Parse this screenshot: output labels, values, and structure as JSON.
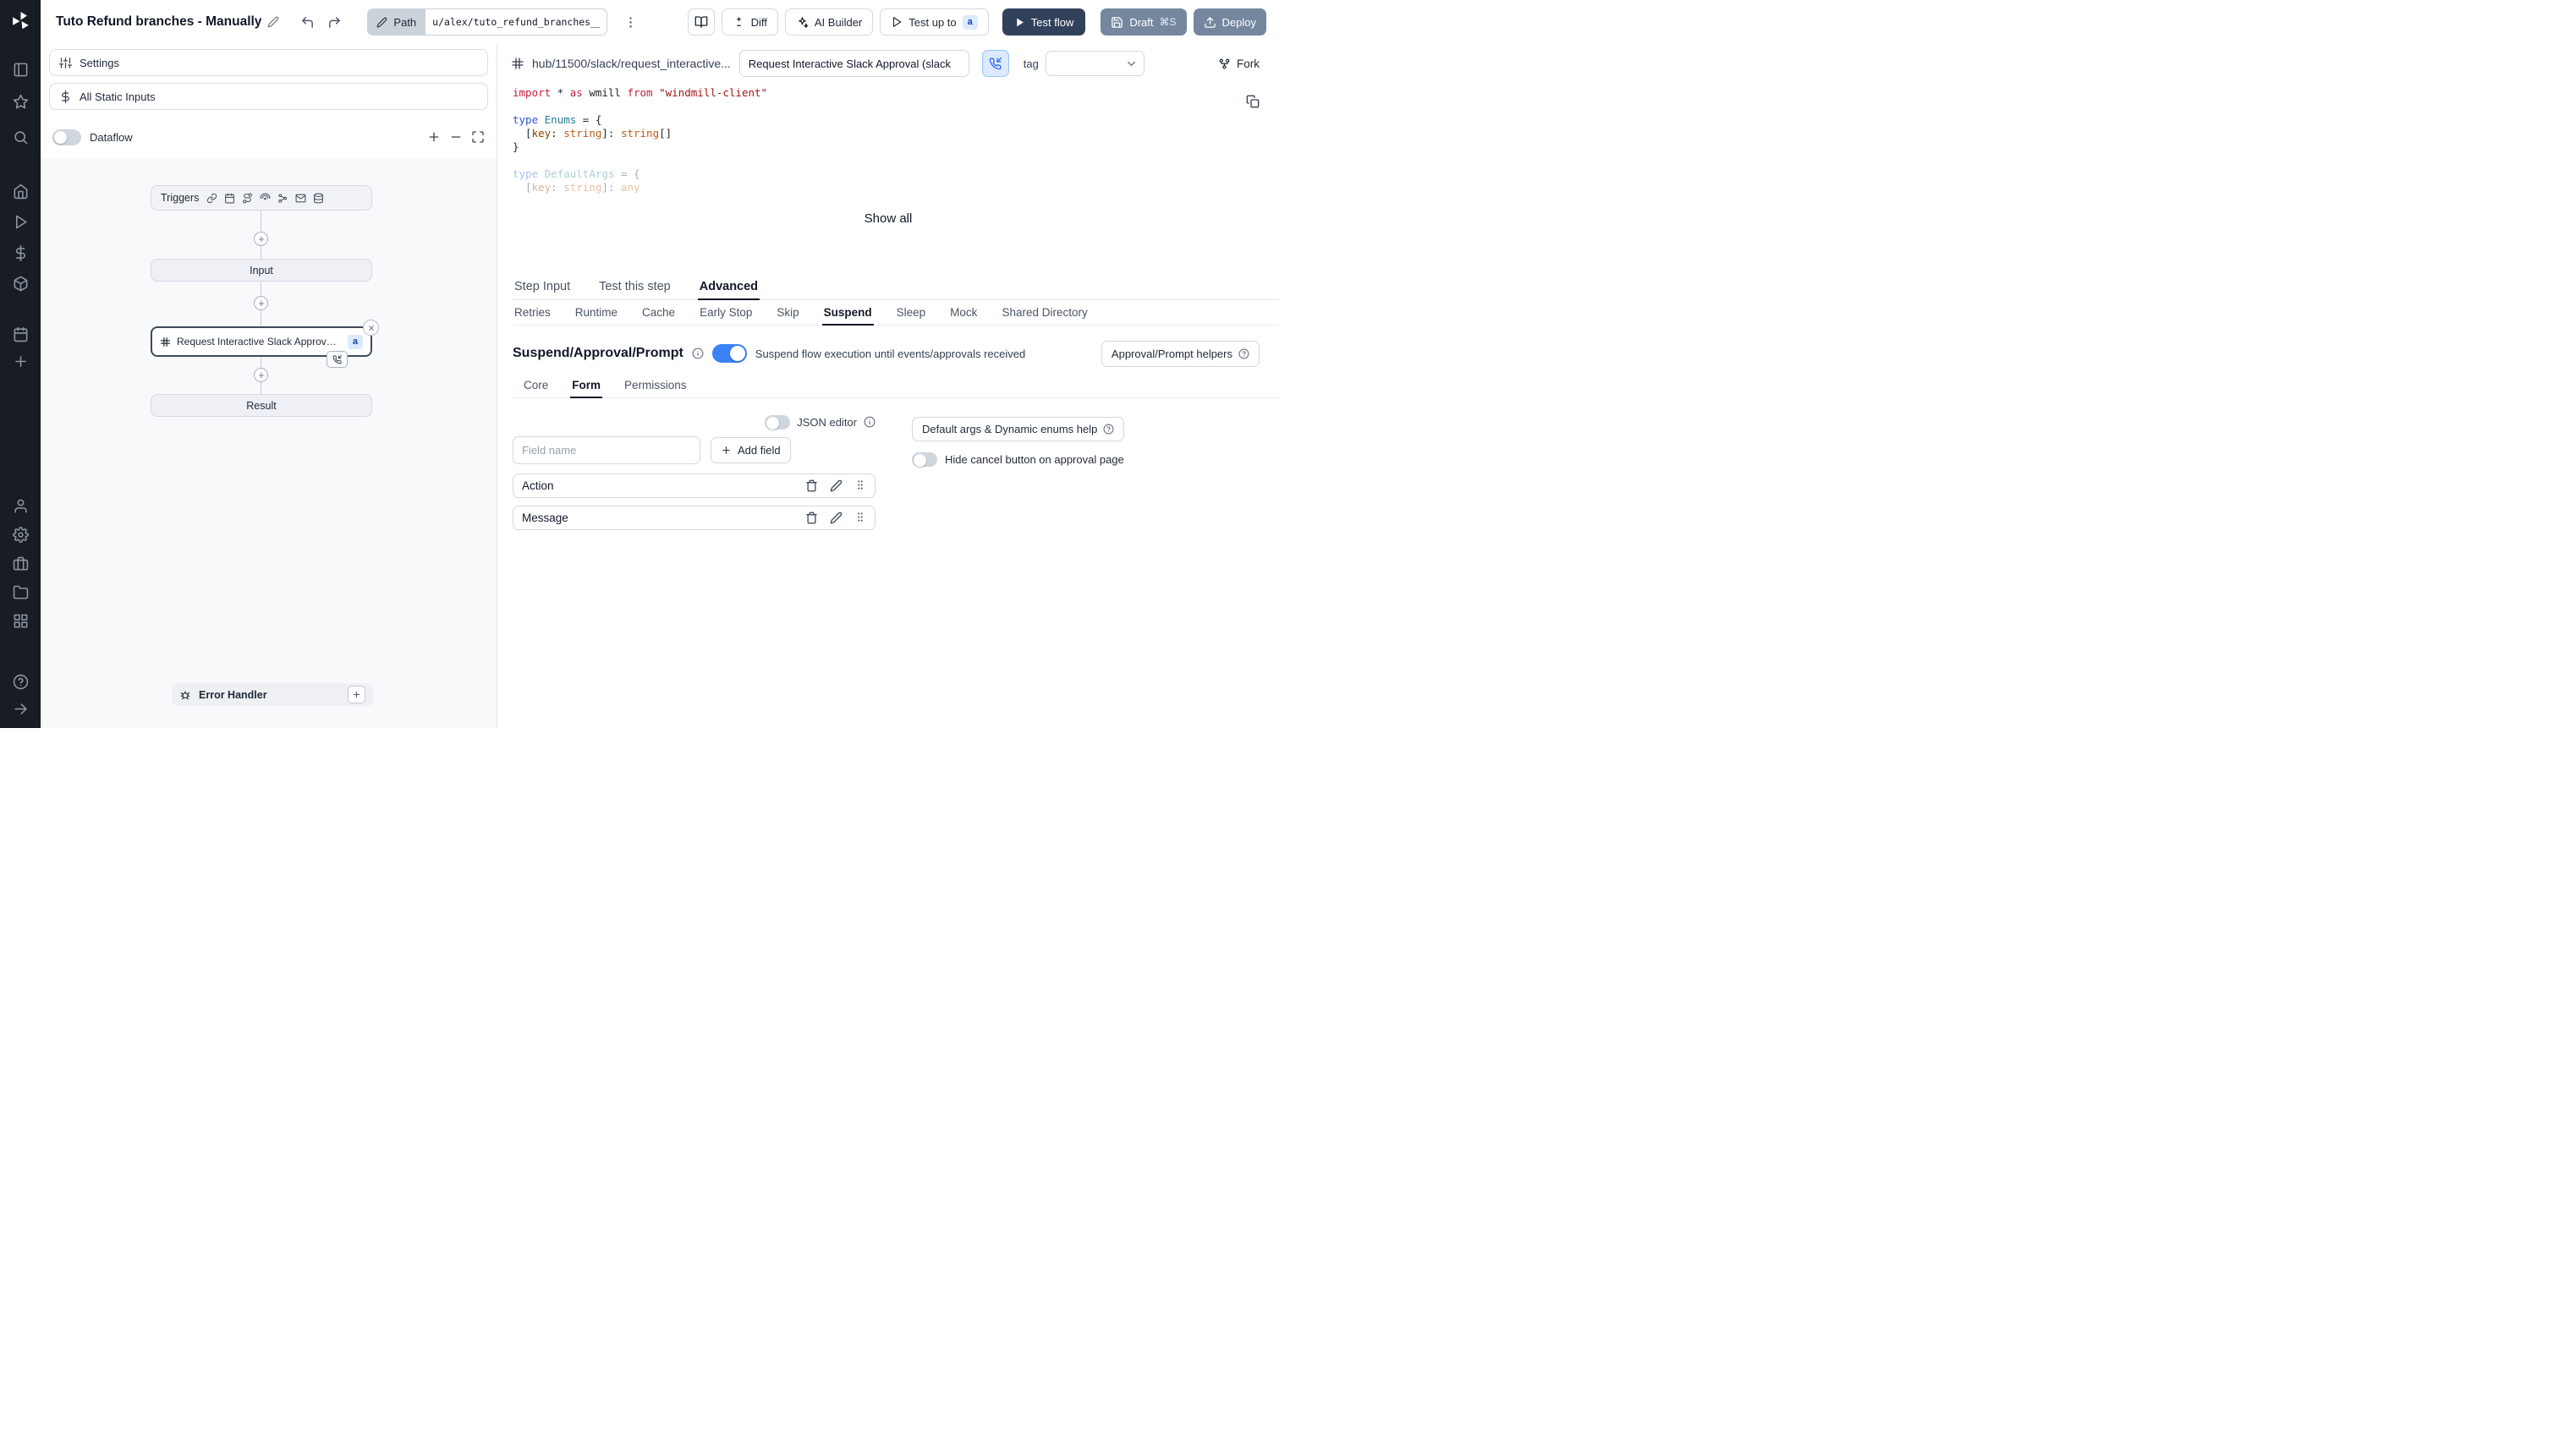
{
  "colors": {
    "accent": "#3b82f6",
    "dark_btn": "#31415b",
    "slate_btn": "#74879f",
    "rail_bg": "#181c23"
  },
  "topbar": {
    "title": "Tuto Refund branches - Manually",
    "path_label": "Path",
    "path_value": "u/alex/tuto_refund_branches__",
    "diff_label": "Diff",
    "ai_builder_label": "AI Builder",
    "test_up_to_label": "Test up to",
    "test_up_to_badge": "a",
    "test_flow_label": "Test flow",
    "draft_label": "Draft",
    "draft_shortcut": "⌘S",
    "deploy_label": "Deploy"
  },
  "sidebar_icons": [
    "windmill-logo",
    "layout",
    "star",
    "search",
    "home",
    "runs",
    "variables",
    "resources",
    "schedules",
    "add",
    "user",
    "settings",
    "workspace",
    "folders",
    "apps",
    "help",
    "expand-sidebar"
  ],
  "left_panel": {
    "settings_label": "Settings",
    "static_inputs_label": "All Static Inputs",
    "dataflow_label": "Dataflow",
    "graph": {
      "triggers_label": "Triggers",
      "trigger_icons": [
        "webhook",
        "schedule",
        "http-route",
        "websocket",
        "kafka",
        "email",
        "database"
      ],
      "input_label": "Input",
      "approval_label": "Request Interactive Slack Approval (...",
      "approval_badge": "a",
      "result_label": "Result",
      "error_handler_label": "Error Handler"
    }
  },
  "right_panel": {
    "hub_path": "hub/11500/slack/request_interactive...",
    "step_name_value": "Request Interactive Slack Approval (slack",
    "tag_label": "tag",
    "fork_label": "Fork",
    "show_all_label": "Show all",
    "code": {
      "lines": [
        {
          "fade": false,
          "tokens": [
            {
              "c": "kw",
              "t": "import"
            },
            {
              "c": "pl",
              "t": " * "
            },
            {
              "c": "kw",
              "t": "as"
            },
            {
              "c": "pl",
              "t": " wmill "
            },
            {
              "c": "kw",
              "t": "from"
            },
            {
              "c": "pl",
              "t": " "
            },
            {
              "c": "str",
              "t": "\"windmill-client\""
            }
          ]
        },
        {
          "fade": false,
          "tokens": []
        },
        {
          "fade": false,
          "tokens": [
            {
              "c": "tkw",
              "t": "type"
            },
            {
              "c": "pl",
              "t": " "
            },
            {
              "c": "tname",
              "t": "Enums"
            },
            {
              "c": "pl",
              "t": " = {"
            }
          ]
        },
        {
          "fade": false,
          "tokens": [
            {
              "c": "pl",
              "t": "  ["
            },
            {
              "c": "prop",
              "t": "key"
            },
            {
              "c": "pl",
              "t": ": "
            },
            {
              "c": "prim",
              "t": "string"
            },
            {
              "c": "pl",
              "t": "]: "
            },
            {
              "c": "prim",
              "t": "string"
            },
            {
              "c": "pl",
              "t": "[]"
            }
          ]
        },
        {
          "fade": false,
          "tokens": [
            {
              "c": "pl",
              "t": "}"
            }
          ]
        },
        {
          "fade": false,
          "tokens": []
        },
        {
          "fade": true,
          "tokens": [
            {
              "c": "tkw",
              "t": "type"
            },
            {
              "c": "pl",
              "t": " "
            },
            {
              "c": "tname",
              "t": "DefaultArgs"
            },
            {
              "c": "pl",
              "t": " = {"
            }
          ]
        },
        {
          "fade": true,
          "tokens": [
            {
              "c": "pl",
              "t": "  ["
            },
            {
              "c": "prop",
              "t": "key"
            },
            {
              "c": "pl",
              "t": ": "
            },
            {
              "c": "prim",
              "t": "string"
            },
            {
              "c": "pl",
              "t": "]: "
            },
            {
              "c": "prim",
              "t": "any"
            }
          ]
        }
      ]
    },
    "tabs": [
      "Step Input",
      "Test this step",
      "Advanced"
    ],
    "active_tab": "Advanced",
    "advanced_tabs": [
      "Retries",
      "Runtime",
      "Cache",
      "Early Stop",
      "Skip",
      "Suspend",
      "Sleep",
      "Mock",
      "Shared Directory"
    ],
    "active_advanced_tab": "Suspend",
    "suspend": {
      "title": "Suspend/Approval/Prompt",
      "toggle_caption": "Suspend flow execution until events/approvals received",
      "helpers_label": "Approval/Prompt helpers",
      "tabs": [
        "Core",
        "Form",
        "Permissions"
      ],
      "active_tab": "Form",
      "json_editor_label": "JSON editor",
      "field_name_placeholder": "Field name",
      "add_field_label": "Add field",
      "default_args_label": "Default args & Dynamic enums help",
      "hide_cancel_label": "Hide cancel button on approval page",
      "fields": [
        {
          "name": "Action"
        },
        {
          "name": "Message"
        }
      ]
    }
  }
}
